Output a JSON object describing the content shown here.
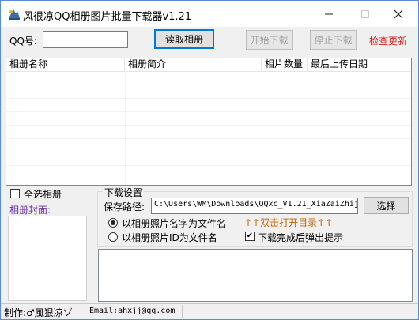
{
  "window": {
    "title": "风很凉QQ相册图片批量下载器v1.21",
    "controls": {
      "minimize": "—",
      "maximize": "☐",
      "close": "✕"
    }
  },
  "top_bar": {
    "qq_label": "QQ号:",
    "qq_value": "",
    "read_album_button": "读取相册",
    "start_download_button": "开始下载",
    "stop_download_button": "停止下载",
    "check_update_link": "检查更新"
  },
  "album_list": {
    "columns": [
      "相册名称",
      "相册简介",
      "相片数量",
      "最后上传日期"
    ],
    "rows": []
  },
  "left_panel": {
    "select_all_label": "全选相册",
    "select_all_checked": false,
    "album_cover_label": "相册封面:"
  },
  "download_settings": {
    "group_title": "下载设置",
    "save_path_label": "保存路径:",
    "save_path_value": "C:\\Users\\WM\\Downloads\\QQxc_V1.21_XiaZaiZhij",
    "choose_button": "选择",
    "option_album_name": "以相册照片名字为文件名",
    "option_album_id": "以相册照片ID为文件名",
    "selected_option": "album_name",
    "open_dir_hint": "↑↑双击打开目录↑↑",
    "popup_on_finish_label": "下载完成后弹出提示",
    "popup_on_finish_checked": true
  },
  "log_area": {
    "text": ""
  },
  "status_bar": {
    "author": "制作:♂風狠凉ゾ",
    "email": "Email:ahxjj@qq.com"
  },
  "colors": {
    "accent_blue": "#0078d7",
    "update_red": "#d41a1a",
    "hint_orange": "#c86400",
    "cover_label_purple": "#6b2fb3"
  }
}
